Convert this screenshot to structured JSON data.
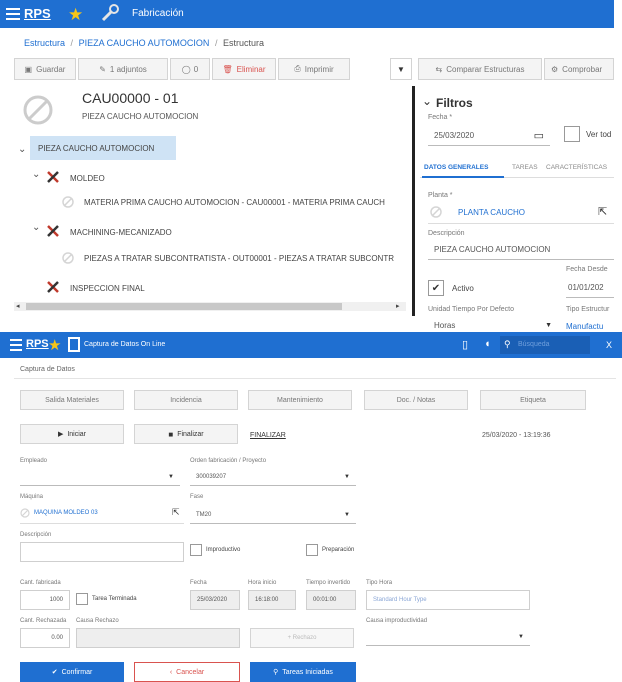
{
  "top": {
    "app_logo": "RPS",
    "title": "Fabricación",
    "breadcrumb": {
      "first": "Estructura",
      "sep1": "/",
      "second": "PIEZA CAUCHO AUTOMOCION",
      "sep2": "/",
      "third": "Estructura"
    },
    "toolbar": {
      "guardar": "Guardar",
      "adjuntos": "1 adjuntos",
      "comments": "0",
      "eliminar": "Eliminar",
      "imprimir": "Imprimir",
      "comparar": "Comparar Estructuras",
      "comprobar": "Comprobar"
    },
    "header": {
      "code": "CAU00000 - 01",
      "subtitle": "PIEZA CAUCHO AUTOMOCION"
    },
    "tree": {
      "root": "PIEZA CAUCHO AUTOMOCION",
      "moldeo": "MOLDEO",
      "materia": "MATERIA PRIMA CAUCHO AUTOMOCION - CAU00001 - MATERIA PRIMA CAUCH",
      "machining": "MACHINING-MECANIZADO",
      "piezas": "PIEZAS A TRATAR SUBCONTRATISTA - OUT00001 - PIEZAS A TRATAR SUBCONTR",
      "inspeccion": "INSPECCION FINAL"
    },
    "filters": {
      "title": "Filtros",
      "fecha_label": "Fecha *",
      "fecha_value": "25/03/2020",
      "ver_todo": "Ver tod",
      "tabs": [
        "DATOS GENERALES",
        "TAREAS",
        "CARACTERÍSTICAS"
      ],
      "planta_label": "Planta *",
      "planta_value": "PLANTA CAUCHO",
      "descripcion_label": "Descripción",
      "descripcion_value": "PIEZA CAUCHO AUTOMOCION",
      "fecha_desde_label": "Fecha Desde",
      "fecha_desde_value": "01/01/202",
      "activo": "Activo",
      "unidad_label": "Unidad Tiempo Por Defecto",
      "unidad_value": "Horas",
      "tipo_label": "Tipo Estructur",
      "tipo_value": "Manufactu"
    }
  },
  "bottom": {
    "app_logo": "RPS",
    "title": "Captura de Datos On Line",
    "search_placeholder": "Búsqueda",
    "close": "X",
    "subtitle": "Captura de Datos",
    "nav_buttons": [
      "Salida Materiales",
      "Incidencia",
      "Mantenimiento",
      "Doc. / Notas",
      "Etiqueta"
    ],
    "iniciar": "Iniciar",
    "finalizar": "Finalizar",
    "status": "FINALIZAR",
    "datetime": "25/03/2020 - 13:19:36",
    "empleado_label": "Empleado",
    "orden_label": "Orden fabricación / Proyecto",
    "orden_value": "300039207",
    "maquina_label": "Máquina",
    "maquina_value": "MAQUINA MOLDEO 03",
    "fase_label": "Fase",
    "fase_value": "TM20",
    "descripcion_label": "Descripción",
    "improductivo": "Improductivo",
    "preparacion": "Preparación",
    "cant_fabricada_label": "Cant. fabricada",
    "cant_fabricada_value": "1000",
    "tarea_terminada": "Tarea Terminada",
    "fecha_label": "Fecha",
    "fecha_value": "25/03/2020",
    "hora_inicio_label": "Hora inicio",
    "hora_inicio_value": "16:18:00",
    "tiempo_label": "Tiempo invertido",
    "tiempo_value": "00:01:00",
    "tipo_hora_label": "Tipo Hora",
    "tipo_hora_placeholder": "Standard Hour Type",
    "cant_rechazada_label": "Cant. Rechazada",
    "cant_rechazada_value": "0.00",
    "causa_rechazo_label": "Causa Rechazo",
    "rechazo_btn": "+ Rechazo",
    "causa_improd_label": "Causa improductividad",
    "confirmar": "Confirmar",
    "cancelar": "Cancelar",
    "tareas": "Tareas Iniciadas"
  },
  "colors": {
    "blue": "#1f6fd1",
    "red": "#d9534f",
    "tree_sel": "#cfe3f5"
  }
}
